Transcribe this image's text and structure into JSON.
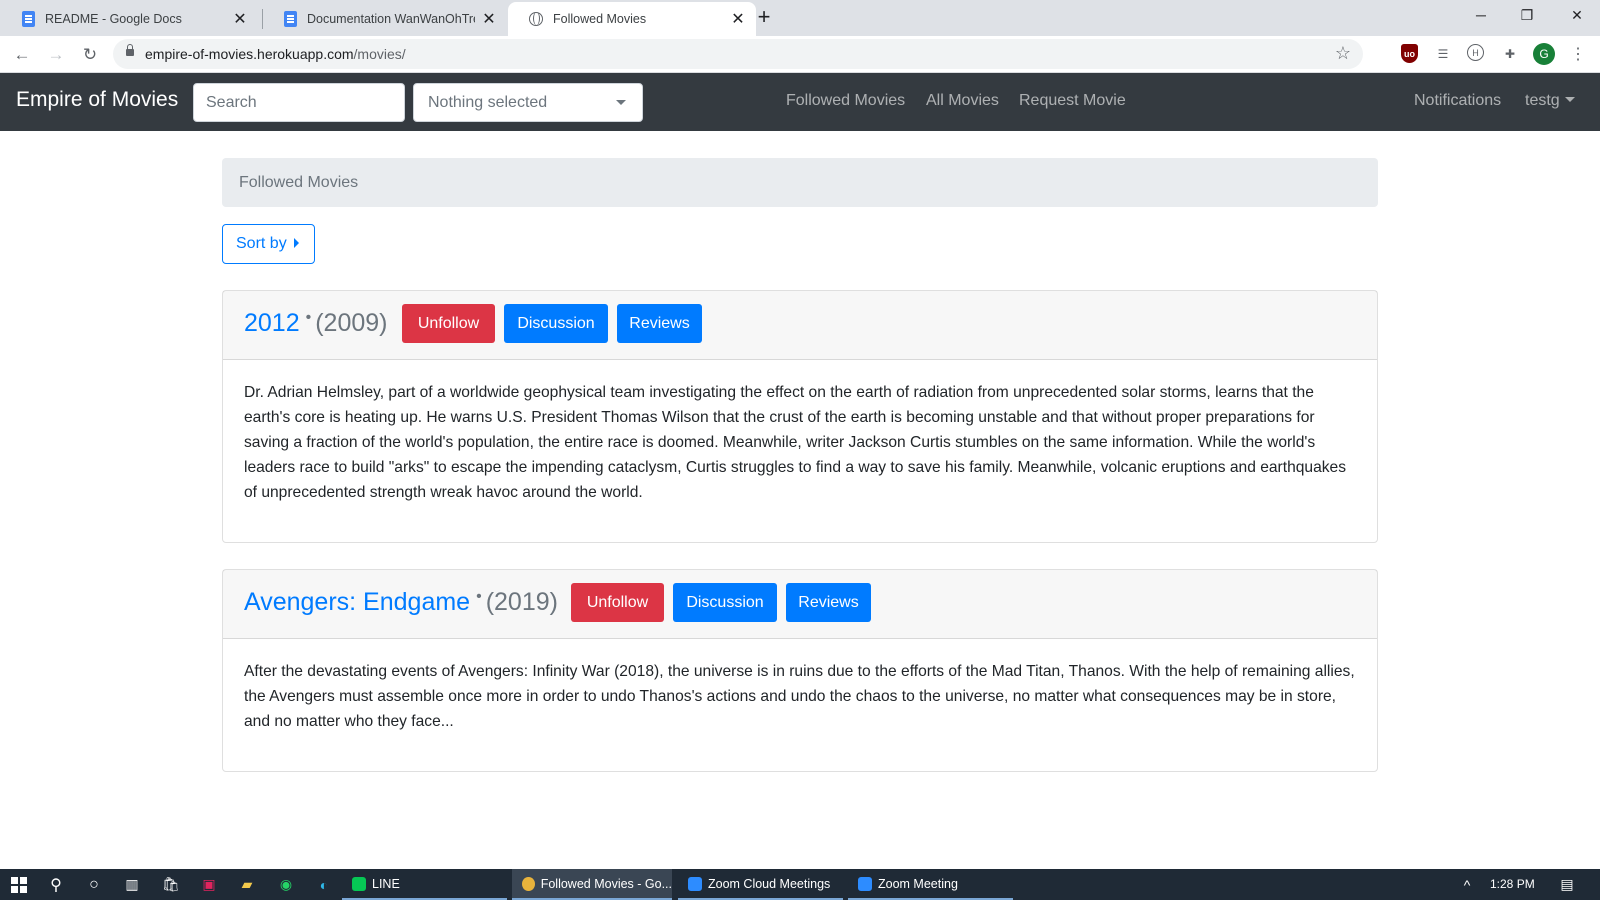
{
  "browser": {
    "tabs": [
      {
        "title": "README - Google Docs",
        "icon": "google-docs-icon"
      },
      {
        "title": "Documentation WanWanOhTree",
        "icon": "google-docs-icon"
      },
      {
        "title": "Followed Movies",
        "icon": "globe-icon",
        "active": true
      }
    ],
    "new_tab": "+",
    "url": {
      "host": "empire-of-movies.herokuapp.com",
      "path": "/movies/"
    },
    "profile_initial": "G"
  },
  "app": {
    "brand": "Empire of Movies",
    "search_placeholder": "Search",
    "genre_select": "Nothing selected",
    "nav_links": [
      "Followed Movies",
      "All Movies",
      "Request Movie"
    ],
    "notifications": "Notifications",
    "user": "testg"
  },
  "page": {
    "breadcrumb": "Followed Movies",
    "sort_label": "Sort by"
  },
  "movies": [
    {
      "title": "2012",
      "year": "(2009)",
      "unfollow": "Unfollow",
      "discussion": "Discussion",
      "reviews": "Reviews",
      "description": "Dr. Adrian Helmsley, part of a worldwide geophysical team investigating the effect on the earth of radiation from unprecedented solar storms, learns that the earth's core is heating up. He warns U.S. President Thomas Wilson that the crust of the earth is becoming unstable and that without proper preparations for saving a fraction of the world's population, the entire race is doomed. Meanwhile, writer Jackson Curtis stumbles on the same information. While the world's leaders race to build \"arks\" to escape the impending cataclysm, Curtis struggles to find a way to save his family. Meanwhile, volcanic eruptions and earthquakes of unprecedented strength wreak havoc around the world."
    },
    {
      "title": "Avengers: Endgame",
      "year": "(2019)",
      "unfollow": "Unfollow",
      "discussion": "Discussion",
      "reviews": "Reviews",
      "description": "After the devastating events of Avengers: Infinity War (2018), the universe is in ruins due to the efforts of the Mad Titan, Thanos. With the help of remaining allies, the Avengers must assemble once more in order to undo Thanos's actions and undo the chaos to the universe, no matter what consequences may be in store, and no matter who they face..."
    }
  ],
  "taskbar": {
    "apps": [
      "LINE",
      "Followed Movies - Go...",
      "Zoom Cloud Meetings",
      "Zoom Meeting"
    ],
    "clock": "1:28 PM"
  },
  "colors": {
    "navbar": "#343a40",
    "primary": "#007bff",
    "danger": "#dc3545"
  }
}
